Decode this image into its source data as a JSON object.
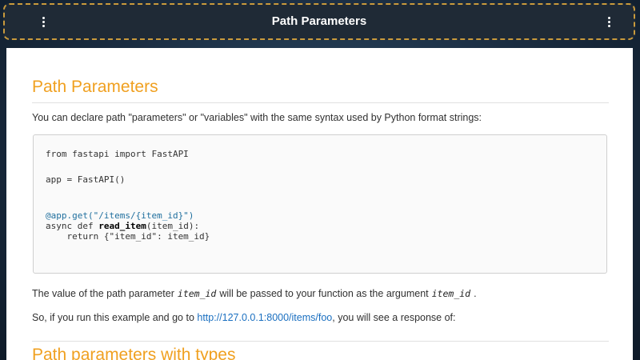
{
  "window": {
    "title": "Path Parameters",
    "left_menu_icon": "more-vert-icon",
    "right_menu_icon": "more-vert-icon"
  },
  "doc": {
    "heading": "Path Parameters",
    "intro": "You can declare path \"parameters\" or \"variables\" with the same syntax used by Python format strings:",
    "code": {
      "line1": "from fastapi import FastAPI",
      "line2": "app = FastAPI()",
      "line3_decorator": "@app.get(\"/items/{item_id}\")",
      "line4_prefix": "async def ",
      "line4_func": "read_item",
      "line4_suffix": "(item_id):",
      "line5": "    return {\"item_id\": item_id}"
    },
    "p2_before": "The value of the path parameter",
    "p2_code1": "item_id",
    "p2_middle": "will be passed to your function as the argument",
    "p2_code2": "item_id",
    "p2_after": ".",
    "p3_before": "So, if you run this example and go to ",
    "p3_link": "http://127.0.0.1:8000/items/foo",
    "p3_after": ", you will see a response of:",
    "next_heading_peek": "Path parameters with types"
  },
  "colors": {
    "heading": "#f0a020",
    "link": "#1a6fc0",
    "titlebar_border": "#c99a3c"
  }
}
